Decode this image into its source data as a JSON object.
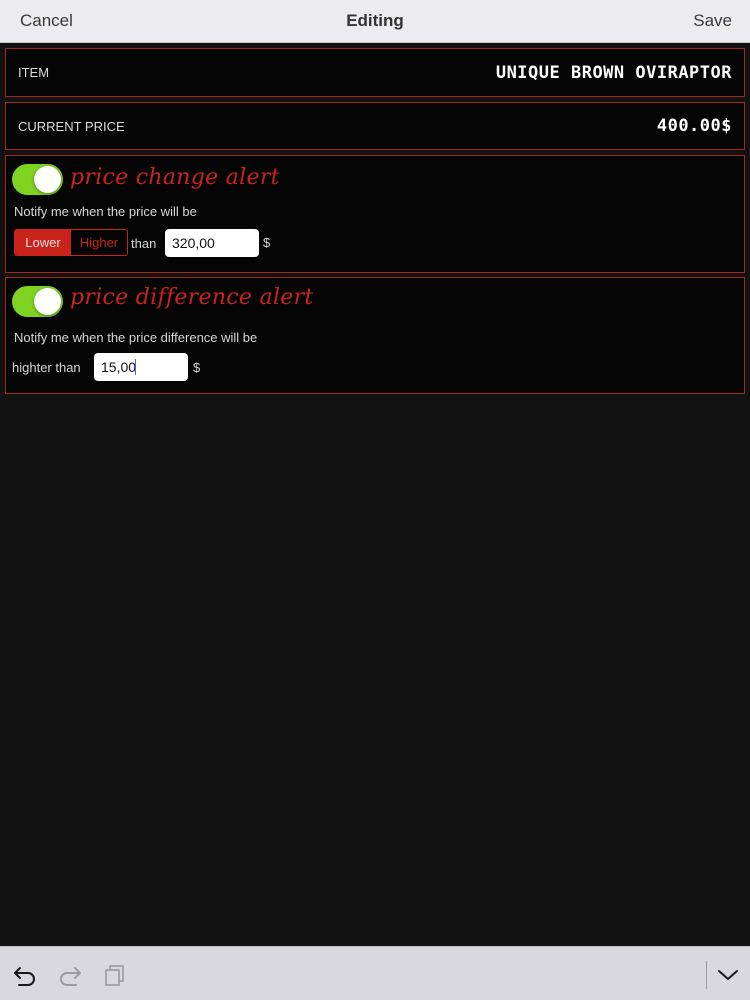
{
  "navbar": {
    "cancel_label": "Cancel",
    "title": "Editing",
    "save_label": "Save"
  },
  "item_row": {
    "label": "ITEM",
    "value": "UNIQUE BROWN OVIRAPTOR"
  },
  "price_row": {
    "label": "CURRENT PRICE",
    "value": "400.00$"
  },
  "price_change_alert": {
    "enabled": true,
    "title": "price change alert",
    "description": "Notify me when the price will be",
    "segments": [
      "Lower",
      "Higher"
    ],
    "selected_segment": "Lower",
    "than_label": "than",
    "value": "320,00",
    "currency": "$"
  },
  "price_difference_alert": {
    "enabled": true,
    "title": "price difference alert",
    "description": "Notify me when the price difference will be",
    "higher_than_label": "highter than",
    "value": "15,00",
    "currency": "$"
  },
  "toolbar": {
    "icons": [
      "undo-icon",
      "redo-icon",
      "clipboard-icon",
      "chevron-down-icon"
    ]
  },
  "colors": {
    "accent_red": "#c9241c",
    "toggle_green": "#7ed321",
    "background": "#121212",
    "panel": "#050505"
  }
}
